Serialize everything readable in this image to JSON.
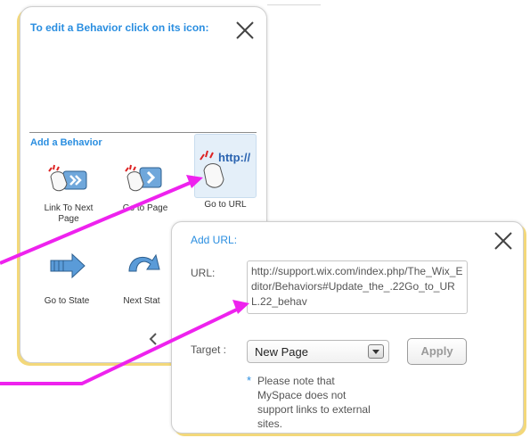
{
  "behaviors_panel": {
    "title": "To edit a Behavior click on its icon:",
    "add_section": "Add a Behavior",
    "items": [
      {
        "label": "Link To Next Page",
        "icon": "link-to-next-page-icon"
      },
      {
        "label": "Go to Page",
        "icon": "go-to-page-icon"
      },
      {
        "label": "Go to URL",
        "icon": "go-to-url-icon",
        "icon_text": "http://"
      },
      {
        "label": "Go to State",
        "icon": "go-to-state-icon"
      },
      {
        "label": "Next Stat",
        "icon": "next-state-icon"
      }
    ]
  },
  "url_panel": {
    "title": "Add URL:",
    "url_label": "URL:",
    "url_value": "http://support.wix.com/index.php/The_Wix_Editor/Behaviors#Update_the_.22Go_to_URL.22_behav",
    "target_label": "Target :",
    "target_value": "New Page",
    "apply_label": "Apply",
    "note_marker": "*",
    "note": "Please note that MySpace does not support links to external sites."
  },
  "colors": {
    "accent": "#2a8ee0",
    "annotation": "#ee22ee",
    "panel_glow": "#f3d87a"
  }
}
